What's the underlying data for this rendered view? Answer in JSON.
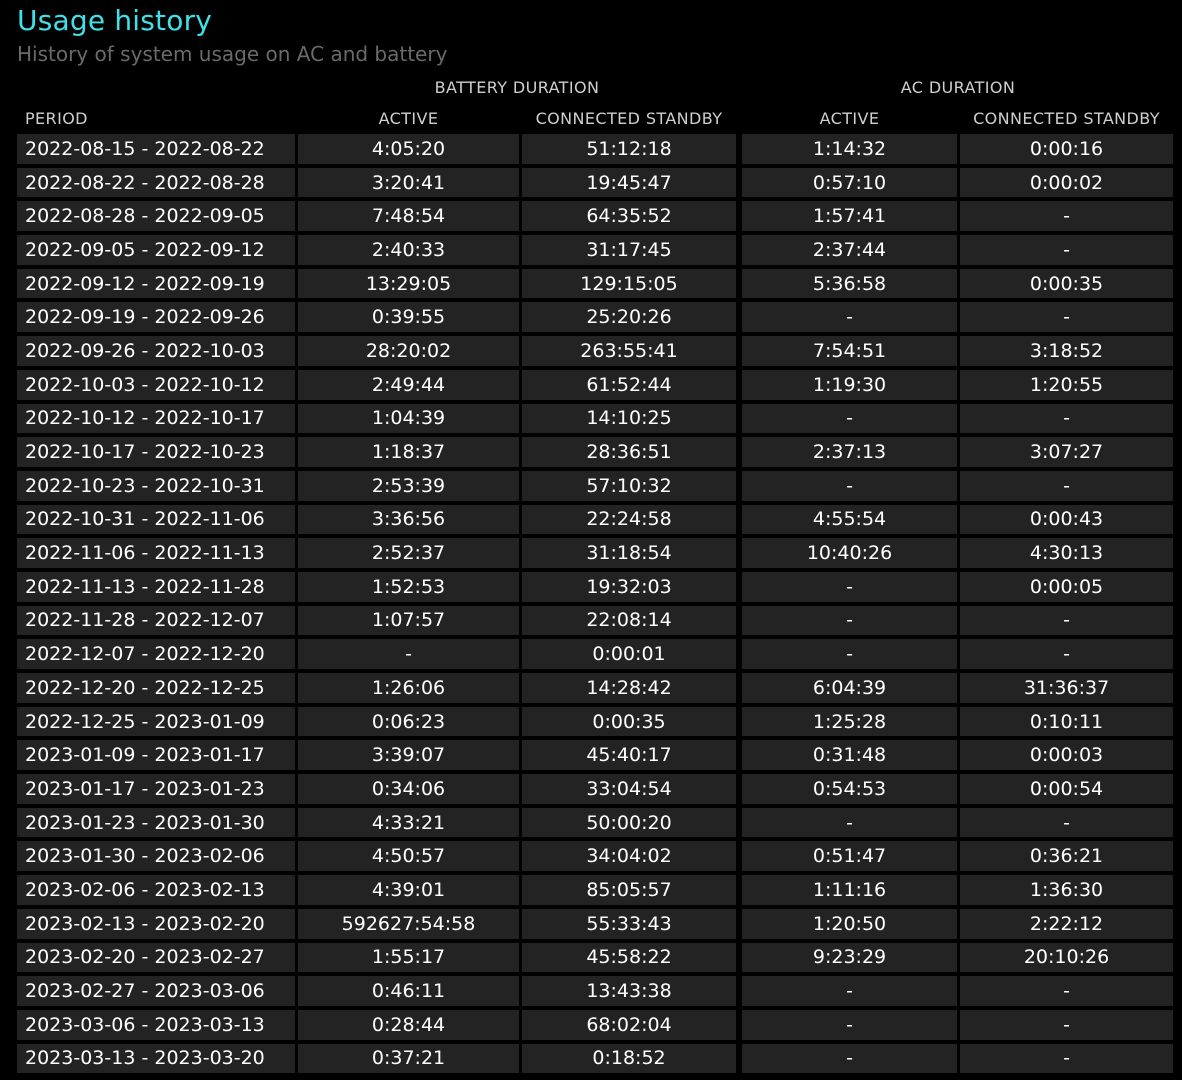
{
  "header": {
    "title": "Usage history",
    "subtitle": "History of system usage on AC and battery"
  },
  "groups": {
    "battery": "BATTERY DURATION",
    "ac": "AC DURATION"
  },
  "columns": {
    "period": "PERIOD",
    "battery_active": "ACTIVE",
    "battery_standby": "CONNECTED STANDBY",
    "ac_active": "ACTIVE",
    "ac_standby": "CONNECTED STANDBY"
  },
  "rows": [
    {
      "period": "2022-08-15 - 2022-08-22",
      "b_active": "4:05:20",
      "b_standby": "51:12:18",
      "ac_active": "1:14:32",
      "ac_standby": "0:00:16"
    },
    {
      "period": "2022-08-22 - 2022-08-28",
      "b_active": "3:20:41",
      "b_standby": "19:45:47",
      "ac_active": "0:57:10",
      "ac_standby": "0:00:02"
    },
    {
      "period": "2022-08-28 - 2022-09-05",
      "b_active": "7:48:54",
      "b_standby": "64:35:52",
      "ac_active": "1:57:41",
      "ac_standby": "-"
    },
    {
      "period": "2022-09-05 - 2022-09-12",
      "b_active": "2:40:33",
      "b_standby": "31:17:45",
      "ac_active": "2:37:44",
      "ac_standby": "-"
    },
    {
      "period": "2022-09-12 - 2022-09-19",
      "b_active": "13:29:05",
      "b_standby": "129:15:05",
      "ac_active": "5:36:58",
      "ac_standby": "0:00:35"
    },
    {
      "period": "2022-09-19 - 2022-09-26",
      "b_active": "0:39:55",
      "b_standby": "25:20:26",
      "ac_active": "-",
      "ac_standby": "-"
    },
    {
      "period": "2022-09-26 - 2022-10-03",
      "b_active": "28:20:02",
      "b_standby": "263:55:41",
      "ac_active": "7:54:51",
      "ac_standby": "3:18:52"
    },
    {
      "period": "2022-10-03 - 2022-10-12",
      "b_active": "2:49:44",
      "b_standby": "61:52:44",
      "ac_active": "1:19:30",
      "ac_standby": "1:20:55"
    },
    {
      "period": "2022-10-12 - 2022-10-17",
      "b_active": "1:04:39",
      "b_standby": "14:10:25",
      "ac_active": "-",
      "ac_standby": "-"
    },
    {
      "period": "2022-10-17 - 2022-10-23",
      "b_active": "1:18:37",
      "b_standby": "28:36:51",
      "ac_active": "2:37:13",
      "ac_standby": "3:07:27"
    },
    {
      "period": "2022-10-23 - 2022-10-31",
      "b_active": "2:53:39",
      "b_standby": "57:10:32",
      "ac_active": "-",
      "ac_standby": "-"
    },
    {
      "period": "2022-10-31 - 2022-11-06",
      "b_active": "3:36:56",
      "b_standby": "22:24:58",
      "ac_active": "4:55:54",
      "ac_standby": "0:00:43"
    },
    {
      "period": "2022-11-06 - 2022-11-13",
      "b_active": "2:52:37",
      "b_standby": "31:18:54",
      "ac_active": "10:40:26",
      "ac_standby": "4:30:13"
    },
    {
      "period": "2022-11-13 - 2022-11-28",
      "b_active": "1:52:53",
      "b_standby": "19:32:03",
      "ac_active": "-",
      "ac_standby": "0:00:05"
    },
    {
      "period": "2022-11-28 - 2022-12-07",
      "b_active": "1:07:57",
      "b_standby": "22:08:14",
      "ac_active": "-",
      "ac_standby": "-"
    },
    {
      "period": "2022-12-07 - 2022-12-20",
      "b_active": "-",
      "b_standby": "0:00:01",
      "ac_active": "-",
      "ac_standby": "-"
    },
    {
      "period": "2022-12-20 - 2022-12-25",
      "b_active": "1:26:06",
      "b_standby": "14:28:42",
      "ac_active": "6:04:39",
      "ac_standby": "31:36:37"
    },
    {
      "period": "2022-12-25 - 2023-01-09",
      "b_active": "0:06:23",
      "b_standby": "0:00:35",
      "ac_active": "1:25:28",
      "ac_standby": "0:10:11"
    },
    {
      "period": "2023-01-09 - 2023-01-17",
      "b_active": "3:39:07",
      "b_standby": "45:40:17",
      "ac_active": "0:31:48",
      "ac_standby": "0:00:03"
    },
    {
      "period": "2023-01-17 - 2023-01-23",
      "b_active": "0:34:06",
      "b_standby": "33:04:54",
      "ac_active": "0:54:53",
      "ac_standby": "0:00:54"
    },
    {
      "period": "2023-01-23 - 2023-01-30",
      "b_active": "4:33:21",
      "b_standby": "50:00:20",
      "ac_active": "-",
      "ac_standby": "-"
    },
    {
      "period": "2023-01-30 - 2023-02-06",
      "b_active": "4:50:57",
      "b_standby": "34:04:02",
      "ac_active": "0:51:47",
      "ac_standby": "0:36:21"
    },
    {
      "period": "2023-02-06 - 2023-02-13",
      "b_active": "4:39:01",
      "b_standby": "85:05:57",
      "ac_active": "1:11:16",
      "ac_standby": "1:36:30"
    },
    {
      "period": "2023-02-13 - 2023-02-20",
      "b_active": "592627:54:58",
      "b_standby": "55:33:43",
      "ac_active": "1:20:50",
      "ac_standby": "2:22:12"
    },
    {
      "period": "2023-02-20 - 2023-02-27",
      "b_active": "1:55:17",
      "b_standby": "45:58:22",
      "ac_active": "9:23:29",
      "ac_standby": "20:10:26"
    },
    {
      "period": "2023-02-27 - 2023-03-06",
      "b_active": "0:46:11",
      "b_standby": "13:43:38",
      "ac_active": "-",
      "ac_standby": "-"
    },
    {
      "period": "2023-03-06 - 2023-03-13",
      "b_active": "0:28:44",
      "b_standby": "68:02:04",
      "ac_active": "-",
      "ac_standby": "-"
    },
    {
      "period": "2023-03-13 - 2023-03-20",
      "b_active": "0:37:21",
      "b_standby": "0:18:52",
      "ac_active": "-",
      "ac_standby": "-"
    }
  ],
  "colors": {
    "background": "#000000",
    "title": "#40e0e8",
    "subtitle": "#6a6a6a",
    "cell": "#232323",
    "header_text": "#cfcfcf"
  }
}
